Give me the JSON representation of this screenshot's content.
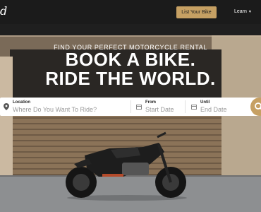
{
  "header": {
    "logo_text": "d",
    "list_bike_label": "List Your Bike",
    "learn_label": "Learn",
    "accent_color": "#c6a063"
  },
  "hero": {
    "tagline": "FIND YOUR PERFECT MOTORCYCLE RENTAL",
    "headline_line1": "BOOK A BIKE.",
    "headline_line2": "RIDE THE WORLD."
  },
  "search": {
    "location_label": "Location",
    "location_placeholder": "Where Do You Want To Ride?",
    "from_label": "From",
    "from_placeholder": "Start Date",
    "until_label": "Until",
    "until_placeholder": "End Date",
    "search_icon": "search-icon"
  }
}
